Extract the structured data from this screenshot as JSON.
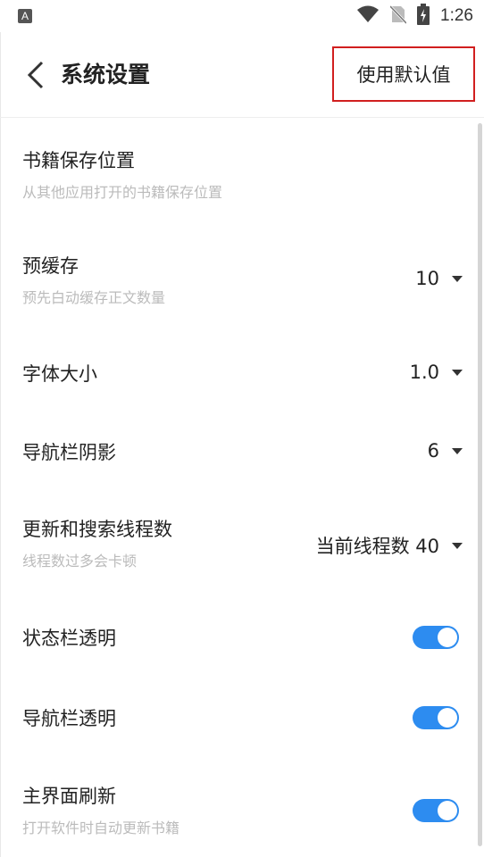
{
  "status_bar": {
    "app_letter": "A",
    "time": "1:26"
  },
  "header": {
    "title": "系统设置",
    "default_button_label": "使用默认值"
  },
  "settings": {
    "book_location": {
      "title": "书籍保存位置",
      "subtitle": "从其他应用打开的书籍保存位置"
    },
    "precache": {
      "title": "预缓存",
      "subtitle": "预先白动缓存正文数量",
      "value": "10"
    },
    "font_size": {
      "title": "字体大小",
      "value": "1.0"
    },
    "nav_shadow": {
      "title": "导航栏阴影",
      "value": "6"
    },
    "threads": {
      "title": "更新和搜索线程数",
      "subtitle": "线程数过多会卡顿",
      "value": "当前线程数 40"
    },
    "status_transparent": {
      "title": "状态栏透明",
      "on": true
    },
    "nav_transparent": {
      "title": "导航栏透明",
      "on": true
    },
    "main_refresh": {
      "title": "主界面刷新",
      "subtitle": "打开软件时自动更新书籍",
      "on": true
    }
  },
  "colors": {
    "accent": "#2d8cf0",
    "highlight_border": "#d11f1f",
    "subtitle": "#bbbbbb"
  },
  "icons": {
    "back": "chevron-left-icon",
    "wifi": "wifi-icon",
    "no_sim": "no-sim-icon",
    "battery": "battery-charging-icon"
  }
}
